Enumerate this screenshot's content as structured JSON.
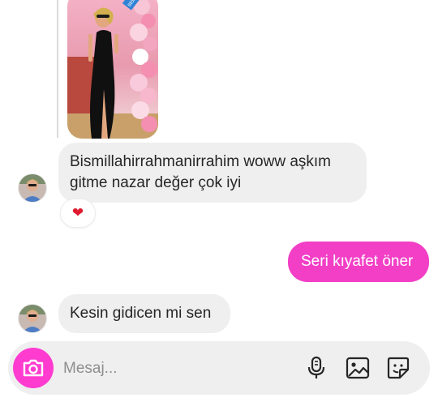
{
  "story": {
    "overlay_text": "https://www.instagram.com/stories/",
    "image_alt": "story-photo-black-dress"
  },
  "messages": [
    {
      "direction": "in",
      "text_lines": [
        "Bismillahirrahmanirrahim woww aşkım",
        "gitme nazar değer çok iyi"
      ],
      "reaction": "❤"
    },
    {
      "direction": "out",
      "text": "Seri kıyafet öner"
    },
    {
      "direction": "in",
      "text": "Kesin gidicen mi sen"
    }
  ],
  "composer": {
    "placeholder": "Mesaj...",
    "icons": [
      "camera-icon",
      "microphone-icon",
      "gallery-icon",
      "sticker-icon"
    ]
  },
  "colors": {
    "outgoing_bubble": "#f23fc6",
    "incoming_bubble": "#efefef",
    "camera_button": "#ff3bd0",
    "reaction_heart": "#e0192e"
  }
}
